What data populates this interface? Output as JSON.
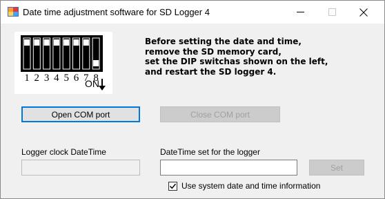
{
  "window": {
    "title": "Date time adjustment software for SD Logger 4",
    "icon": "app-icon",
    "controls": [
      "minimize-icon",
      "maximize-icon",
      "close-icon"
    ]
  },
  "dip_switch": {
    "numbers": [
      "1",
      "2",
      "3",
      "4",
      "5",
      "6",
      "7",
      "8"
    ],
    "on_label": "ON",
    "switch_on": [
      false,
      false,
      false,
      false,
      false,
      false,
      false,
      true
    ]
  },
  "instructions": {
    "lines": [
      "Before setting the date and time,",
      "remove the SD memory card,",
      "set the DIP switchas shown on the left,",
      "and restart the SD logger 4."
    ]
  },
  "buttons": {
    "open_com": "Open COM port",
    "close_com": "Close COM port",
    "set": "Set"
  },
  "logger_clock": {
    "label": "Logger clock  DateTime",
    "value": ""
  },
  "datetime_set": {
    "label": "DateTime set for the logger",
    "value": ""
  },
  "use_system_time": {
    "label": "Use system date and time information",
    "checked": true
  },
  "colors": {
    "focus_border": "#0078d7",
    "window_bg": "#f0f0f0"
  }
}
